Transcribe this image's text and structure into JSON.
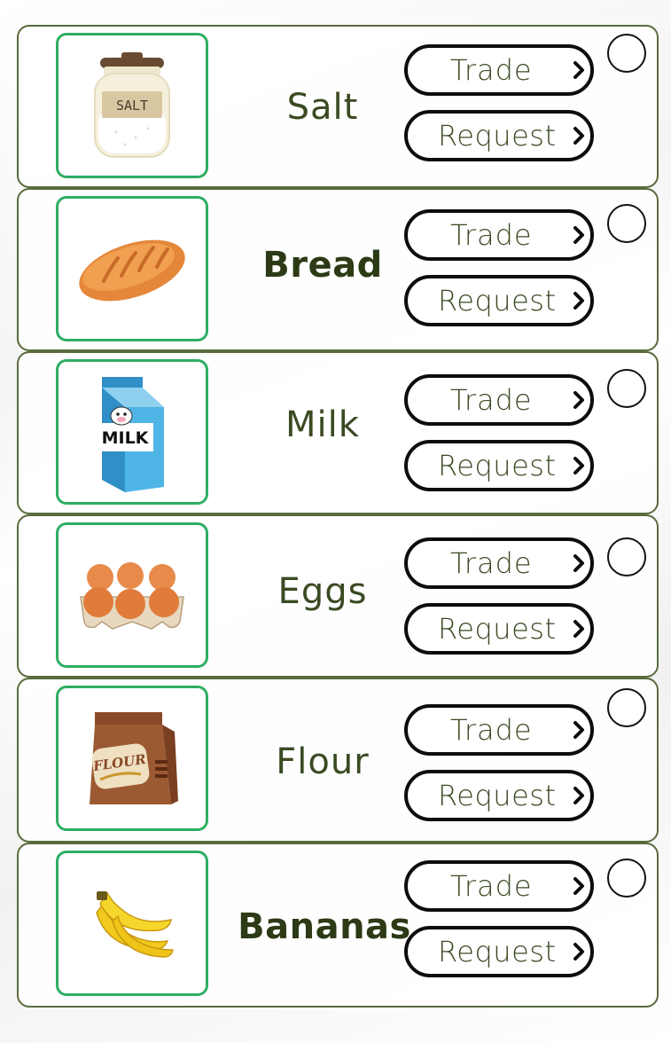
{
  "items": [
    {
      "name": "Salt",
      "icon": "salt-jar-icon",
      "trade_label": "Trade",
      "request_label": "Request",
      "jar_label": "SALT",
      "bold": false
    },
    {
      "name": "Bread",
      "icon": "bread-icon",
      "trade_label": "Trade",
      "request_label": "Request",
      "bold": true
    },
    {
      "name": "Milk",
      "icon": "milk-carton-icon",
      "trade_label": "Trade",
      "request_label": "Request",
      "carton_label": "MILK",
      "bold": false
    },
    {
      "name": "Eggs",
      "icon": "eggs-tray-icon",
      "trade_label": "Trade",
      "request_label": "Request",
      "bold": false
    },
    {
      "name": "Flour",
      "icon": "flour-bag-icon",
      "trade_label": "Trade",
      "request_label": "Request",
      "bag_label": "FLOUR",
      "bold": false
    },
    {
      "name": "Bananas",
      "icon": "bananas-icon",
      "trade_label": "Trade",
      "request_label": "Request",
      "bold": true
    }
  ],
  "colors": {
    "card_border": "#5a6b3c",
    "image_border": "#2fae63",
    "text": "#3a4a22",
    "button_border": "#0d0d0d"
  }
}
